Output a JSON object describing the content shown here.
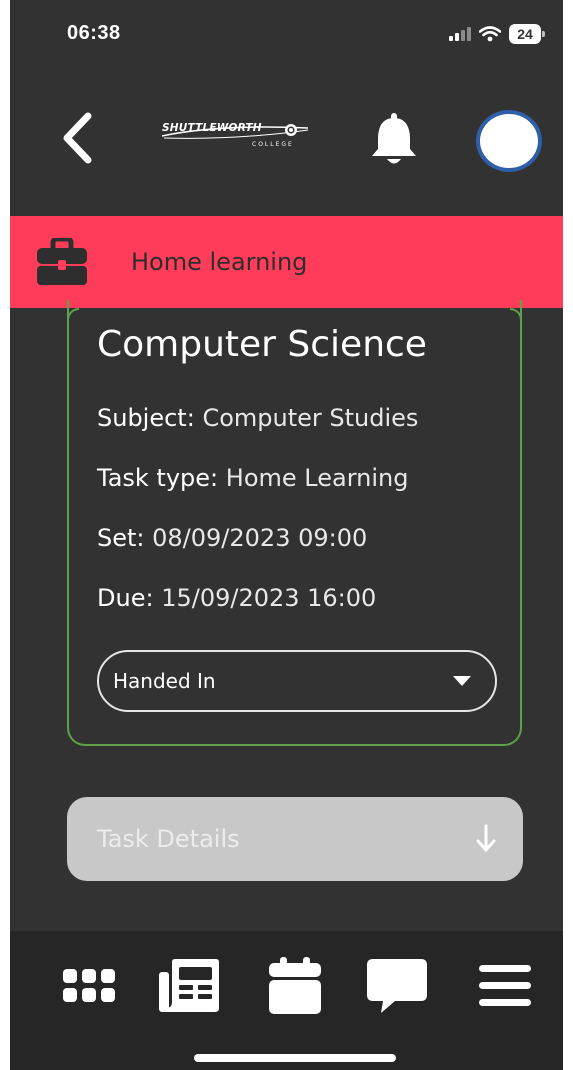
{
  "status_bar": {
    "time": "06:38",
    "battery": "24"
  },
  "header": {
    "logo_name": "SHUTTLEWORTH",
    "logo_sub": "COLLEGE",
    "back_icon": "chevron-left-icon",
    "bell_icon": "bell-icon"
  },
  "section": {
    "title": "Home learning",
    "icon": "briefcase-icon",
    "color": "#ff3c5a"
  },
  "task": {
    "title": "Computer Science",
    "subject_label": "Subject:",
    "subject_value": "Computer Studies",
    "type_label": "Task type:",
    "type_value": "Home Learning",
    "set_label": "Set:",
    "set_value": "08/09/2023 09:00",
    "due_label": "Due:",
    "due_value": "15/09/2023 16:00",
    "status_value": "Handed In",
    "border_color": "#5fa04a"
  },
  "task_details": {
    "label": "Task Details",
    "icon": "arrow-down-icon"
  },
  "bottom_nav": {
    "items": [
      {
        "name": "dashboard",
        "icon": "grid-icon"
      },
      {
        "name": "newsfeed",
        "icon": "newspaper-icon"
      },
      {
        "name": "calendar",
        "icon": "calendar-icon"
      },
      {
        "name": "messages",
        "icon": "chat-icon"
      },
      {
        "name": "menu",
        "icon": "hamburger-menu-icon"
      }
    ]
  }
}
